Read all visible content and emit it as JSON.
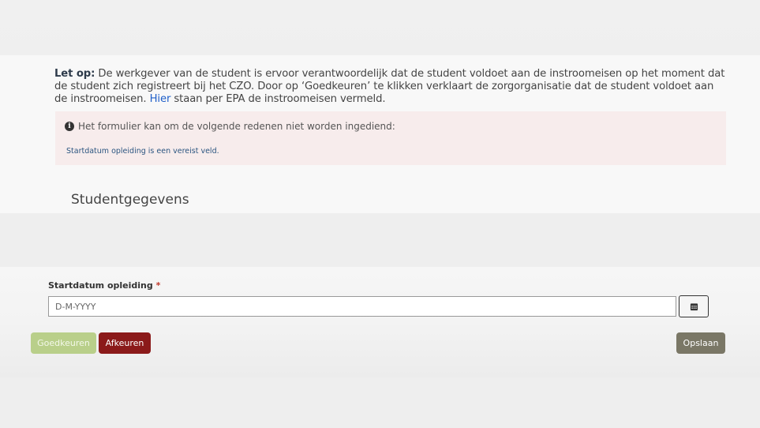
{
  "notice": {
    "label": "Let op:",
    "text_before_link": " De werkgever van de student is ervoor verantwoordelijk dat de student voldoet aan de instroomeisen op het moment dat de student zich registreert bij het CZO. Door op ‘Goedkeuren’ te klikken verklaart de zorgorganisatie dat de student voldoet aan de instroomeisen. ",
    "link_text": "Hier",
    "text_after_link": " staan per EPA de instroomeisen vermeld."
  },
  "error": {
    "header": "Het formulier kan om de volgende redenen niet worden ingediend:",
    "items": [
      "Startdatum opleiding is een vereist veld."
    ]
  },
  "section": {
    "title": "Studentgegevens"
  },
  "form": {
    "start_date_label": "Startdatum opleiding",
    "required_marker": "*",
    "start_date_placeholder": "D-M-YYYY",
    "start_date_value": ""
  },
  "buttons": {
    "approve": "Goedkeuren",
    "reject": "Afkeuren",
    "save": "Opslaan"
  },
  "icons": {
    "info": "info-circle-icon",
    "calendar": "calendar-icon"
  },
  "colors": {
    "approve": "#b9cf8a",
    "reject": "#8b1a1a",
    "save": "#7a7766",
    "error_bg": "#f7ecec",
    "link": "#1f5fc9"
  }
}
